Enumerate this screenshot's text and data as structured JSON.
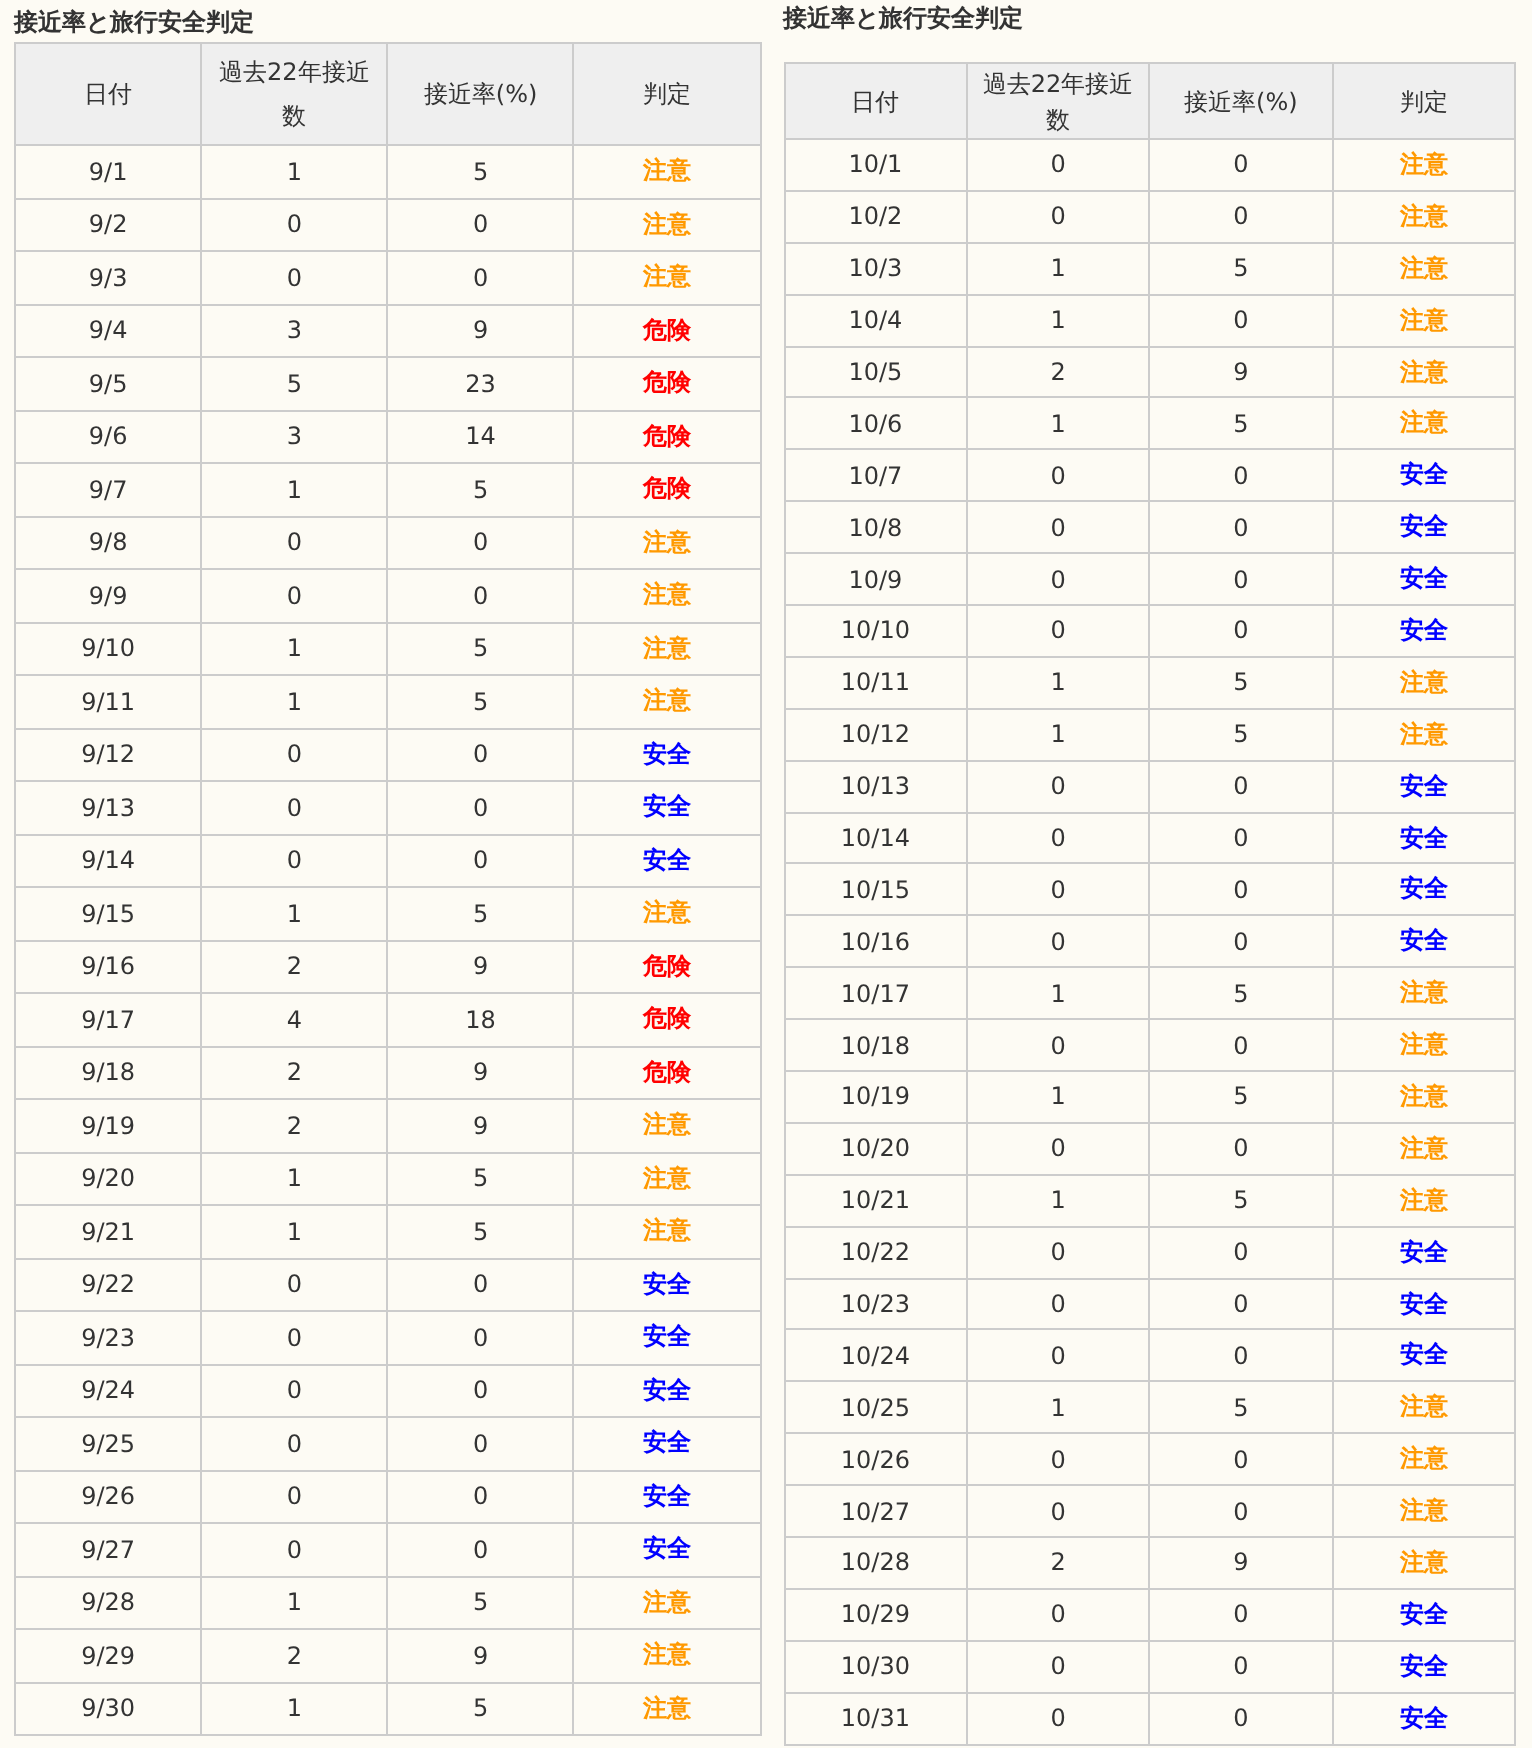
{
  "tables": [
    {
      "title": "接近率と旅行安全判定",
      "columns": [
        "日付",
        "過去22年接近数",
        "接近率(%)",
        "判定"
      ],
      "rows": [
        {
          "date": "9/1",
          "count": "1",
          "rate": "5",
          "verdict": "注意",
          "color": "#ff9900"
        },
        {
          "date": "9/2",
          "count": "0",
          "rate": "0",
          "verdict": "注意",
          "color": "#ff9900"
        },
        {
          "date": "9/3",
          "count": "0",
          "rate": "0",
          "verdict": "注意",
          "color": "#ff9900"
        },
        {
          "date": "9/4",
          "count": "3",
          "rate": "9",
          "verdict": "危険",
          "color": "#ff0000"
        },
        {
          "date": "9/5",
          "count": "5",
          "rate": "23",
          "verdict": "危険",
          "color": "#ff0000"
        },
        {
          "date": "9/6",
          "count": "3",
          "rate": "14",
          "verdict": "危険",
          "color": "#ff0000"
        },
        {
          "date": "9/7",
          "count": "1",
          "rate": "5",
          "verdict": "危険",
          "color": "#ff0000"
        },
        {
          "date": "9/8",
          "count": "0",
          "rate": "0",
          "verdict": "注意",
          "color": "#ff9900"
        },
        {
          "date": "9/9",
          "count": "0",
          "rate": "0",
          "verdict": "注意",
          "color": "#ff9900"
        },
        {
          "date": "9/10",
          "count": "1",
          "rate": "5",
          "verdict": "注意",
          "color": "#ff9900"
        },
        {
          "date": "9/11",
          "count": "1",
          "rate": "5",
          "verdict": "注意",
          "color": "#ff9900"
        },
        {
          "date": "9/12",
          "count": "0",
          "rate": "0",
          "verdict": "安全",
          "color": "#0000ff"
        },
        {
          "date": "9/13",
          "count": "0",
          "rate": "0",
          "verdict": "安全",
          "color": "#0000ff"
        },
        {
          "date": "9/14",
          "count": "0",
          "rate": "0",
          "verdict": "安全",
          "color": "#0000ff"
        },
        {
          "date": "9/15",
          "count": "1",
          "rate": "5",
          "verdict": "注意",
          "color": "#ff9900"
        },
        {
          "date": "9/16",
          "count": "2",
          "rate": "9",
          "verdict": "危険",
          "color": "#ff0000"
        },
        {
          "date": "9/17",
          "count": "4",
          "rate": "18",
          "verdict": "危険",
          "color": "#ff0000"
        },
        {
          "date": "9/18",
          "count": "2",
          "rate": "9",
          "verdict": "危険",
          "color": "#ff0000"
        },
        {
          "date": "9/19",
          "count": "2",
          "rate": "9",
          "verdict": "注意",
          "color": "#ff9900"
        },
        {
          "date": "9/20",
          "count": "1",
          "rate": "5",
          "verdict": "注意",
          "color": "#ff9900"
        },
        {
          "date": "9/21",
          "count": "1",
          "rate": "5",
          "verdict": "注意",
          "color": "#ff9900"
        },
        {
          "date": "9/22",
          "count": "0",
          "rate": "0",
          "verdict": "安全",
          "color": "#0000ff"
        },
        {
          "date": "9/23",
          "count": "0",
          "rate": "0",
          "verdict": "安全",
          "color": "#0000ff"
        },
        {
          "date": "9/24",
          "count": "0",
          "rate": "0",
          "verdict": "安全",
          "color": "#0000ff"
        },
        {
          "date": "9/25",
          "count": "0",
          "rate": "0",
          "verdict": "安全",
          "color": "#0000ff"
        },
        {
          "date": "9/26",
          "count": "0",
          "rate": "0",
          "verdict": "安全",
          "color": "#0000ff"
        },
        {
          "date": "9/27",
          "count": "0",
          "rate": "0",
          "verdict": "安全",
          "color": "#0000ff"
        },
        {
          "date": "9/28",
          "count": "1",
          "rate": "5",
          "verdict": "注意",
          "color": "#ff9900"
        },
        {
          "date": "9/29",
          "count": "2",
          "rate": "9",
          "verdict": "注意",
          "color": "#ff9900"
        },
        {
          "date": "9/30",
          "count": "1",
          "rate": "5",
          "verdict": "注意",
          "color": "#ff9900"
        }
      ]
    },
    {
      "title": "接近率と旅行安全判定",
      "columns": [
        "日付",
        "過去22年接近数",
        "接近率(%)",
        "判定"
      ],
      "rows": [
        {
          "date": "10/1",
          "count": "0",
          "rate": "0",
          "verdict": "注意",
          "color": "#ff9900"
        },
        {
          "date": "10/2",
          "count": "0",
          "rate": "0",
          "verdict": "注意",
          "color": "#ff9900"
        },
        {
          "date": "10/3",
          "count": "1",
          "rate": "5",
          "verdict": "注意",
          "color": "#ff9900"
        },
        {
          "date": "10/4",
          "count": "1",
          "rate": "0",
          "verdict": "注意",
          "color": "#ff9900"
        },
        {
          "date": "10/5",
          "count": "2",
          "rate": "9",
          "verdict": "注意",
          "color": "#ff9900"
        },
        {
          "date": "10/6",
          "count": "1",
          "rate": "5",
          "verdict": "注意",
          "color": "#ff9900"
        },
        {
          "date": "10/7",
          "count": "0",
          "rate": "0",
          "verdict": "安全",
          "color": "#0000ff"
        },
        {
          "date": "10/8",
          "count": "0",
          "rate": "0",
          "verdict": "安全",
          "color": "#0000ff"
        },
        {
          "date": "10/9",
          "count": "0",
          "rate": "0",
          "verdict": "安全",
          "color": "#0000ff"
        },
        {
          "date": "10/10",
          "count": "0",
          "rate": "0",
          "verdict": "安全",
          "color": "#0000ff"
        },
        {
          "date": "10/11",
          "count": "1",
          "rate": "5",
          "verdict": "注意",
          "color": "#ff9900"
        },
        {
          "date": "10/12",
          "count": "1",
          "rate": "5",
          "verdict": "注意",
          "color": "#ff9900"
        },
        {
          "date": "10/13",
          "count": "0",
          "rate": "0",
          "verdict": "安全",
          "color": "#0000ff"
        },
        {
          "date": "10/14",
          "count": "0",
          "rate": "0",
          "verdict": "安全",
          "color": "#0000ff"
        },
        {
          "date": "10/15",
          "count": "0",
          "rate": "0",
          "verdict": "安全",
          "color": "#0000ff"
        },
        {
          "date": "10/16",
          "count": "0",
          "rate": "0",
          "verdict": "安全",
          "color": "#0000ff"
        },
        {
          "date": "10/17",
          "count": "1",
          "rate": "5",
          "verdict": "注意",
          "color": "#ff9900"
        },
        {
          "date": "10/18",
          "count": "0",
          "rate": "0",
          "verdict": "注意",
          "color": "#ff9900"
        },
        {
          "date": "10/19",
          "count": "1",
          "rate": "5",
          "verdict": "注意",
          "color": "#ff9900"
        },
        {
          "date": "10/20",
          "count": "0",
          "rate": "0",
          "verdict": "注意",
          "color": "#ff9900"
        },
        {
          "date": "10/21",
          "count": "1",
          "rate": "5",
          "verdict": "注意",
          "color": "#ff9900"
        },
        {
          "date": "10/22",
          "count": "0",
          "rate": "0",
          "verdict": "安全",
          "color": "#0000ff"
        },
        {
          "date": "10/23",
          "count": "0",
          "rate": "0",
          "verdict": "安全",
          "color": "#0000ff"
        },
        {
          "date": "10/24",
          "count": "0",
          "rate": "0",
          "verdict": "安全",
          "color": "#0000ff"
        },
        {
          "date": "10/25",
          "count": "1",
          "rate": "5",
          "verdict": "注意",
          "color": "#ff9900"
        },
        {
          "date": "10/26",
          "count": "0",
          "rate": "0",
          "verdict": "注意",
          "color": "#ff9900"
        },
        {
          "date": "10/27",
          "count": "0",
          "rate": "0",
          "verdict": "注意",
          "color": "#ff9900"
        },
        {
          "date": "10/28",
          "count": "2",
          "rate": "9",
          "verdict": "注意",
          "color": "#ff9900"
        },
        {
          "date": "10/29",
          "count": "0",
          "rate": "0",
          "verdict": "安全",
          "color": "#0000ff"
        },
        {
          "date": "10/30",
          "count": "0",
          "rate": "0",
          "verdict": "安全",
          "color": "#0000ff"
        },
        {
          "date": "10/31",
          "count": "0",
          "rate": "0",
          "verdict": "安全",
          "color": "#0000ff"
        }
      ]
    }
  ]
}
